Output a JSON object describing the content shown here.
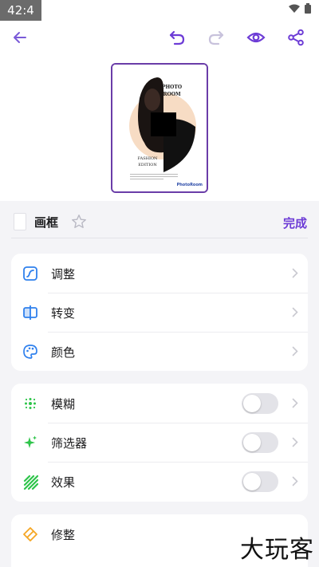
{
  "status_bar": {
    "time": "42:4"
  },
  "toolbar": {
    "back_icon": "arrow-left-icon",
    "undo_icon": "undo-icon",
    "redo_icon": "redo-icon",
    "preview_icon": "eye-icon",
    "share_icon": "share-icon"
  },
  "preview": {
    "poster_title_1": "PHOTO",
    "poster_title_2": "ROOM",
    "poster_subtitle_1": "FASHION",
    "poster_subtitle_2": "EDITION",
    "poster_brand": "PhotoRoom"
  },
  "sheet": {
    "title": "画框",
    "done_label": "完成"
  },
  "groups": [
    {
      "items": [
        {
          "label": "调整",
          "icon": "adjust-icon"
        },
        {
          "label": "转变",
          "icon": "transform-icon"
        },
        {
          "label": "颜色",
          "icon": "palette-icon"
        }
      ]
    },
    {
      "items": [
        {
          "label": "模糊",
          "icon": "blur-icon",
          "toggle_on": false
        },
        {
          "label": "筛选器",
          "icon": "filter-icon",
          "toggle_on": false
        },
        {
          "label": "效果",
          "icon": "effects-icon",
          "toggle_on": false
        }
      ]
    },
    {
      "items": [
        {
          "label": "修整",
          "icon": "trim-icon"
        }
      ]
    }
  ],
  "watermark": "大玩客",
  "colors": {
    "accent": "#6d3cd6",
    "blue_icon": "#2f80ed",
    "green_icon": "#2ec44a"
  }
}
